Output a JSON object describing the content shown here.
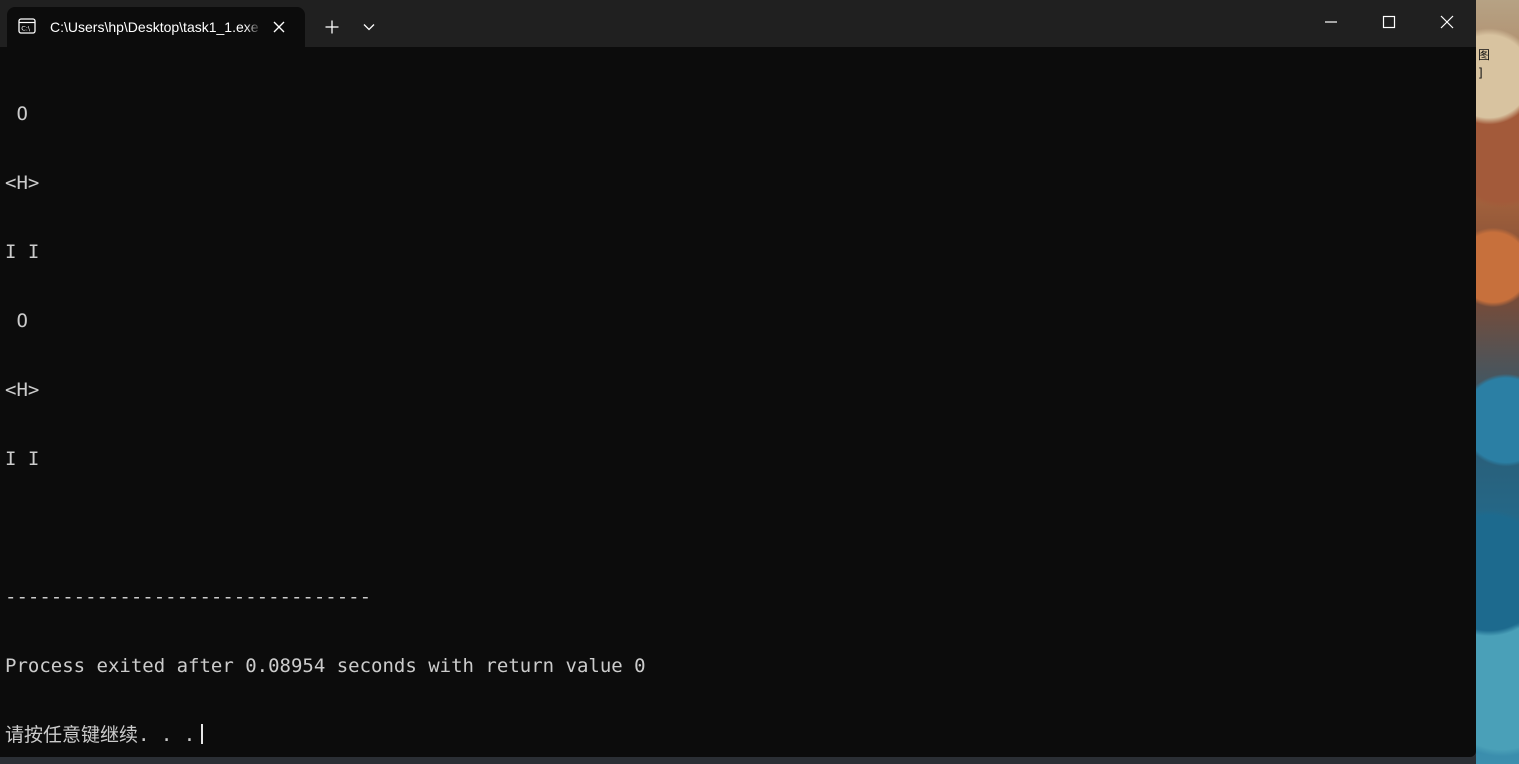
{
  "window": {
    "tab_title": "C:\\Users\\hp\\Desktop\\task1_1.exe",
    "icons": {
      "tab": "console-icon",
      "close_tab": "close-icon",
      "new_tab": "plus-icon",
      "dropdown": "chevron-down-icon",
      "minimize": "minimize-icon",
      "maximize": "maximize-icon",
      "close_window": "close-icon"
    }
  },
  "console": {
    "lines": [
      " O",
      "<H>",
      "I I",
      " O",
      "<H>",
      "I I",
      "",
      "--------------------------------",
      "Process exited after 0.08954 seconds with return value 0",
      "请按任意键继续. . ."
    ]
  },
  "desktop": {
    "edge_label": [
      "图",
      "]"
    ]
  },
  "colors": {
    "console_bg": "#0c0c0c",
    "console_fg": "#cccccc",
    "titlebar_bg": "#202020"
  }
}
